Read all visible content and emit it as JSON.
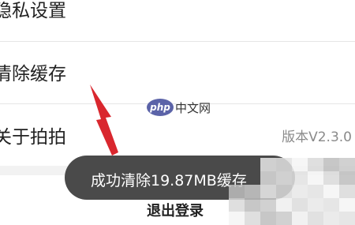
{
  "settings": {
    "privacy_label": "隐私设置",
    "clear_cache_label": "清除缓存",
    "about_label": "关于拍拍",
    "version_text": "版本V2.3.0",
    "logout_label": "退出登录"
  },
  "toast": {
    "message": "成功清除19.87MB缓存"
  },
  "watermark": {
    "logo_text": "php",
    "site_text": "中文网"
  },
  "colors": {
    "toast_background": "#4a4a4a",
    "arrow": "#d9272e",
    "watermark_logo": "#5b63a8",
    "divider": "#e6e6e6"
  },
  "icons": {
    "annotation": "red-arrow-icon"
  }
}
